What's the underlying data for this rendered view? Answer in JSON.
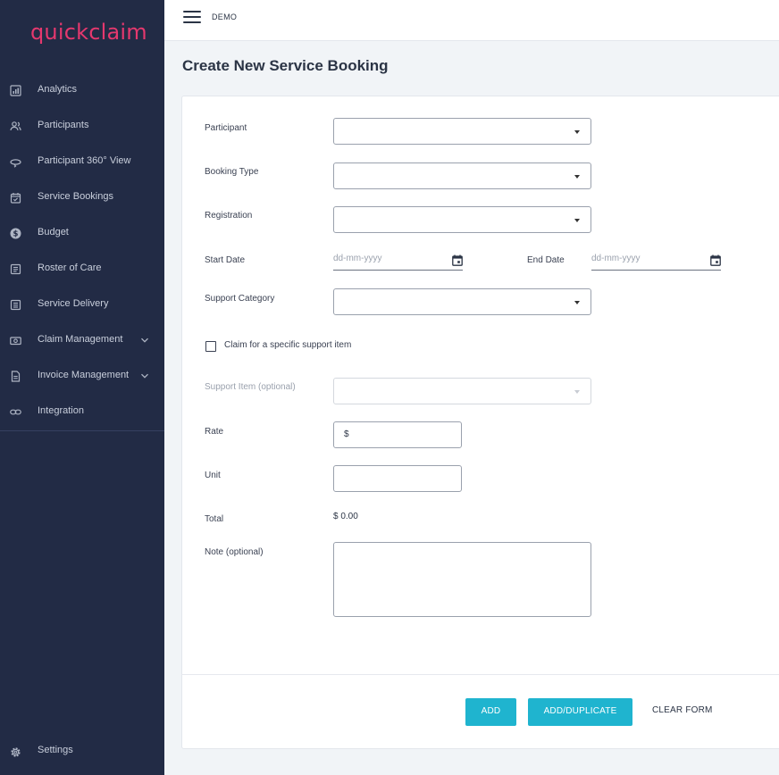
{
  "app": {
    "logo": "quickclaim"
  },
  "topbar": {
    "org": "DEMO"
  },
  "sidebar": {
    "items": [
      {
        "label": "Analytics",
        "icon": "analytics-icon"
      },
      {
        "label": "Participants",
        "icon": "participants-icon"
      },
      {
        "label": "Participant 360° View",
        "icon": "view-360-icon"
      },
      {
        "label": "Service Bookings",
        "icon": "calendar-icon"
      },
      {
        "label": "Budget",
        "icon": "dollar-icon"
      },
      {
        "label": "Roster of Care",
        "icon": "roster-icon"
      },
      {
        "label": "Service Delivery",
        "icon": "delivery-icon"
      },
      {
        "label": "Claim Management",
        "icon": "claim-icon",
        "expandable": true
      },
      {
        "label": "Invoice Management",
        "icon": "invoice-icon",
        "expandable": true
      },
      {
        "label": "Integration",
        "icon": "link-icon"
      }
    ],
    "settings": "Settings"
  },
  "page": {
    "title": "Create New Service Booking"
  },
  "form": {
    "participant_label": "Participant",
    "booking_type_label": "Booking Type",
    "registration_label": "Registration",
    "start_date_label": "Start Date",
    "start_date_placeholder": "dd-mm-yyyy",
    "end_date_label": "End Date",
    "end_date_placeholder": "dd-mm-yyyy",
    "support_category_label": "Support Category",
    "specific_item_checkbox_label": "Claim for a specific support item",
    "specific_item_checked": false,
    "support_item_label": "Support Item (optional)",
    "rate_label": "Rate",
    "rate_prefix": "$",
    "unit_label": "Unit",
    "total_label": "Total",
    "total_value": "$ 0.00",
    "note_label": "Note (optional)"
  },
  "actions": {
    "add": "ADD",
    "add_duplicate": "ADD/DUPLICATE",
    "clear": "CLEAR FORM"
  },
  "colors": {
    "sidebar_bg": "#222b45",
    "brand": "#e5386e",
    "primary_button": "#1fb4cf",
    "page_bg": "#f1f4f7"
  }
}
